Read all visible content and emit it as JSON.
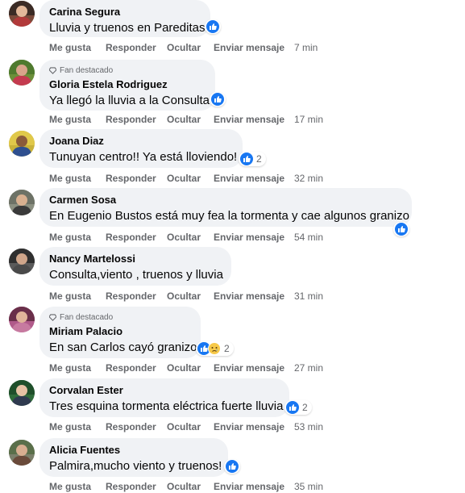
{
  "actions": {
    "like": "Me gusta",
    "reply": "Responder",
    "hide": "Ocultar",
    "message": "Enviar mensaje"
  },
  "colors": {
    "like_blue": "#1877f2",
    "bubble_bg": "#f0f2f5",
    "meta_gray": "#65676b"
  },
  "comments": [
    {
      "author": "Carina Segura",
      "text": "Lluvia y truenos en Pareditas",
      "time": "7 min",
      "fan": "",
      "reactions": "like",
      "count": ""
    },
    {
      "author": "Gloria Estela Rodriguez",
      "text": "Ya llegó la lluvia a la Consulta",
      "time": "17 min",
      "fan": "Fan destacado",
      "reactions": "like",
      "count": ""
    },
    {
      "author": "Joana Diaz",
      "text": "Tunuyan centro!! Ya está lloviendo!",
      "time": "32 min",
      "fan": "",
      "reactions": "like",
      "count": "2"
    },
    {
      "author": "Carmen Sosa",
      "text": "En Eugenio Bustos está muy fea la tormenta y cae algunos granizo",
      "time": "54 min",
      "fan": "",
      "reactions": "like",
      "count": ""
    },
    {
      "author": "Nancy Martelossi",
      "text": "Consulta,viento , truenos y lluvia",
      "time": "31 min",
      "fan": "",
      "reactions": "",
      "count": ""
    },
    {
      "author": "Miriam Palacio",
      "text": "En san Carlos cayó granizo",
      "time": "27 min",
      "fan": "Fan destacado",
      "reactions": "like-sad",
      "count": "2"
    },
    {
      "author": "Corvalan Ester",
      "text": "Tres esquina tormenta eléctrica fuerte lluvia",
      "time": "53 min",
      "fan": "",
      "reactions": "like",
      "count": "2"
    },
    {
      "author": "Alicia Fuentes",
      "text": "Palmira,mucho viento y truenos!",
      "time": "35 min",
      "fan": "",
      "reactions": "like",
      "count": ""
    }
  ]
}
